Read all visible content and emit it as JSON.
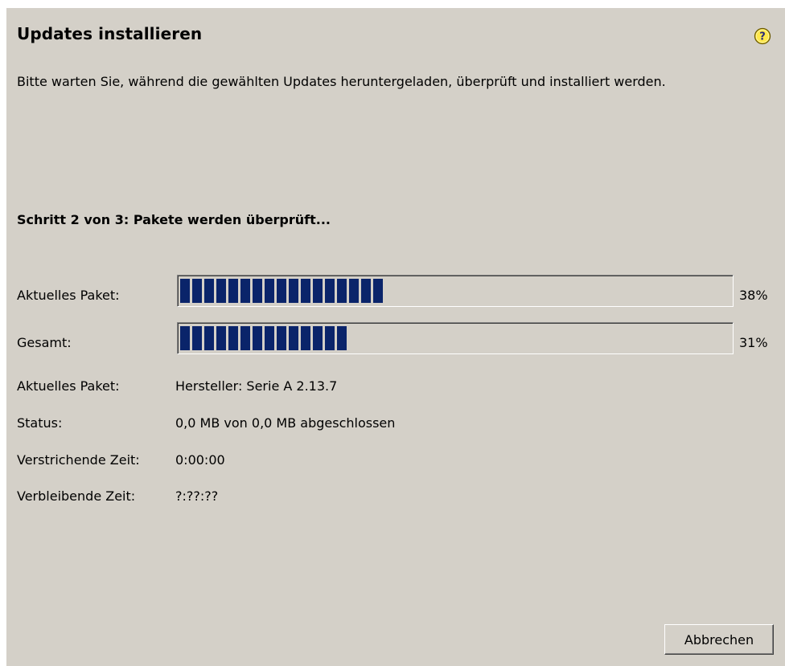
{
  "dialog": {
    "title": "Updates installieren",
    "help_icon": "help-icon",
    "description": "Bitte warten Sie, während die gewählten Updates heruntergeladen, überprüft und installiert werden.",
    "step_text": "Schritt 2 von 3: Pakete werden überprüft..."
  },
  "progress": {
    "current": {
      "label": "Aktuelles Paket:",
      "percent_text": "38%",
      "fraction": 0.38
    },
    "total": {
      "label": "Gesamt:",
      "percent_text": "31%",
      "fraction": 0.31
    }
  },
  "details": [
    {
      "label": "Aktuelles Paket:",
      "value": "Hersteller: Serie A 2.13.7"
    },
    {
      "label": "Status:",
      "value": "0,0 MB von 0,0 MB abgeschlossen"
    },
    {
      "label": "Verstrichende Zeit:",
      "value": "0:00:00"
    },
    {
      "label": "Verbleibende Zeit:",
      "value": "?:??:??"
    }
  ],
  "buttons": {
    "cancel_label": "Abbrechen"
  },
  "colors": {
    "dialog_background": "#d4d0c8",
    "progress_fill": "#0a246a",
    "help_icon_fill": "#ffe84a"
  }
}
